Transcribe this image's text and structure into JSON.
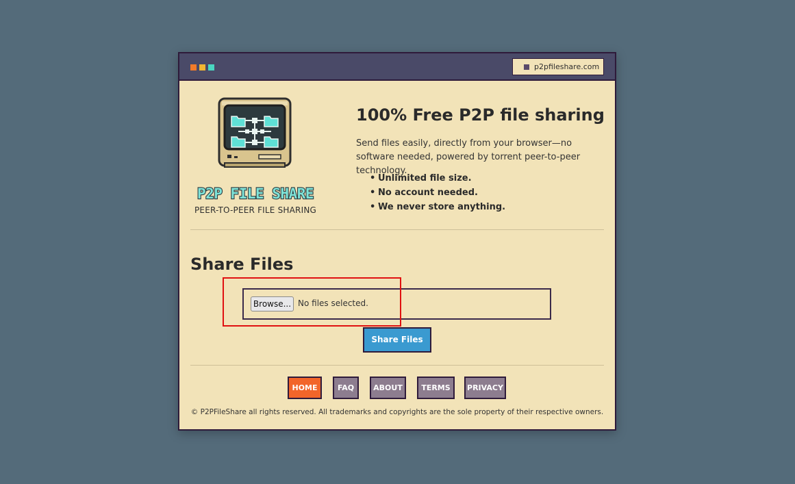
{
  "browser": {
    "url": "p2pfileshare.com"
  },
  "brand": {
    "logo_text": "P2P FILE SHARE",
    "caption": "PEER-TO-PEER FILE SHARING"
  },
  "hero": {
    "title": "100% Free P2P file sharing",
    "description": "Send files easily, directly from your browser—no software needed, powered by torrent peer-to-peer technology.",
    "features": [
      "Unlimited file size.",
      "No account needed.",
      "We never store anything."
    ]
  },
  "share": {
    "title": "Share Files",
    "browse_label": "Browse...",
    "file_status": "No files selected.",
    "submit_label": "Share Files"
  },
  "nav": {
    "items": [
      {
        "label": "HOME",
        "active": true
      },
      {
        "label": "FAQ",
        "active": false
      },
      {
        "label": "ABOUT",
        "active": false
      },
      {
        "label": "TERMS",
        "active": false
      },
      {
        "label": "PRIVACY",
        "active": false
      }
    ]
  },
  "footer": {
    "copyright": "© P2PFileShare all rights reserved. All trademarks and copyrights are the sole property of their respective owners."
  },
  "colors": {
    "page_background": "#546b7a",
    "window_background": "#f2e3b8",
    "titlebar": "#4a4a68",
    "accent_active": "#f2652a",
    "nav_inactive": "#8d7d8f",
    "primary_button": "#3a9ad0",
    "highlight": "#e01010"
  },
  "icons": {
    "window_controls": [
      "dot-orange",
      "dot-yellow",
      "dot-teal"
    ],
    "url_icon": "lock-icon",
    "logo": "retro-computer-network-icon"
  }
}
